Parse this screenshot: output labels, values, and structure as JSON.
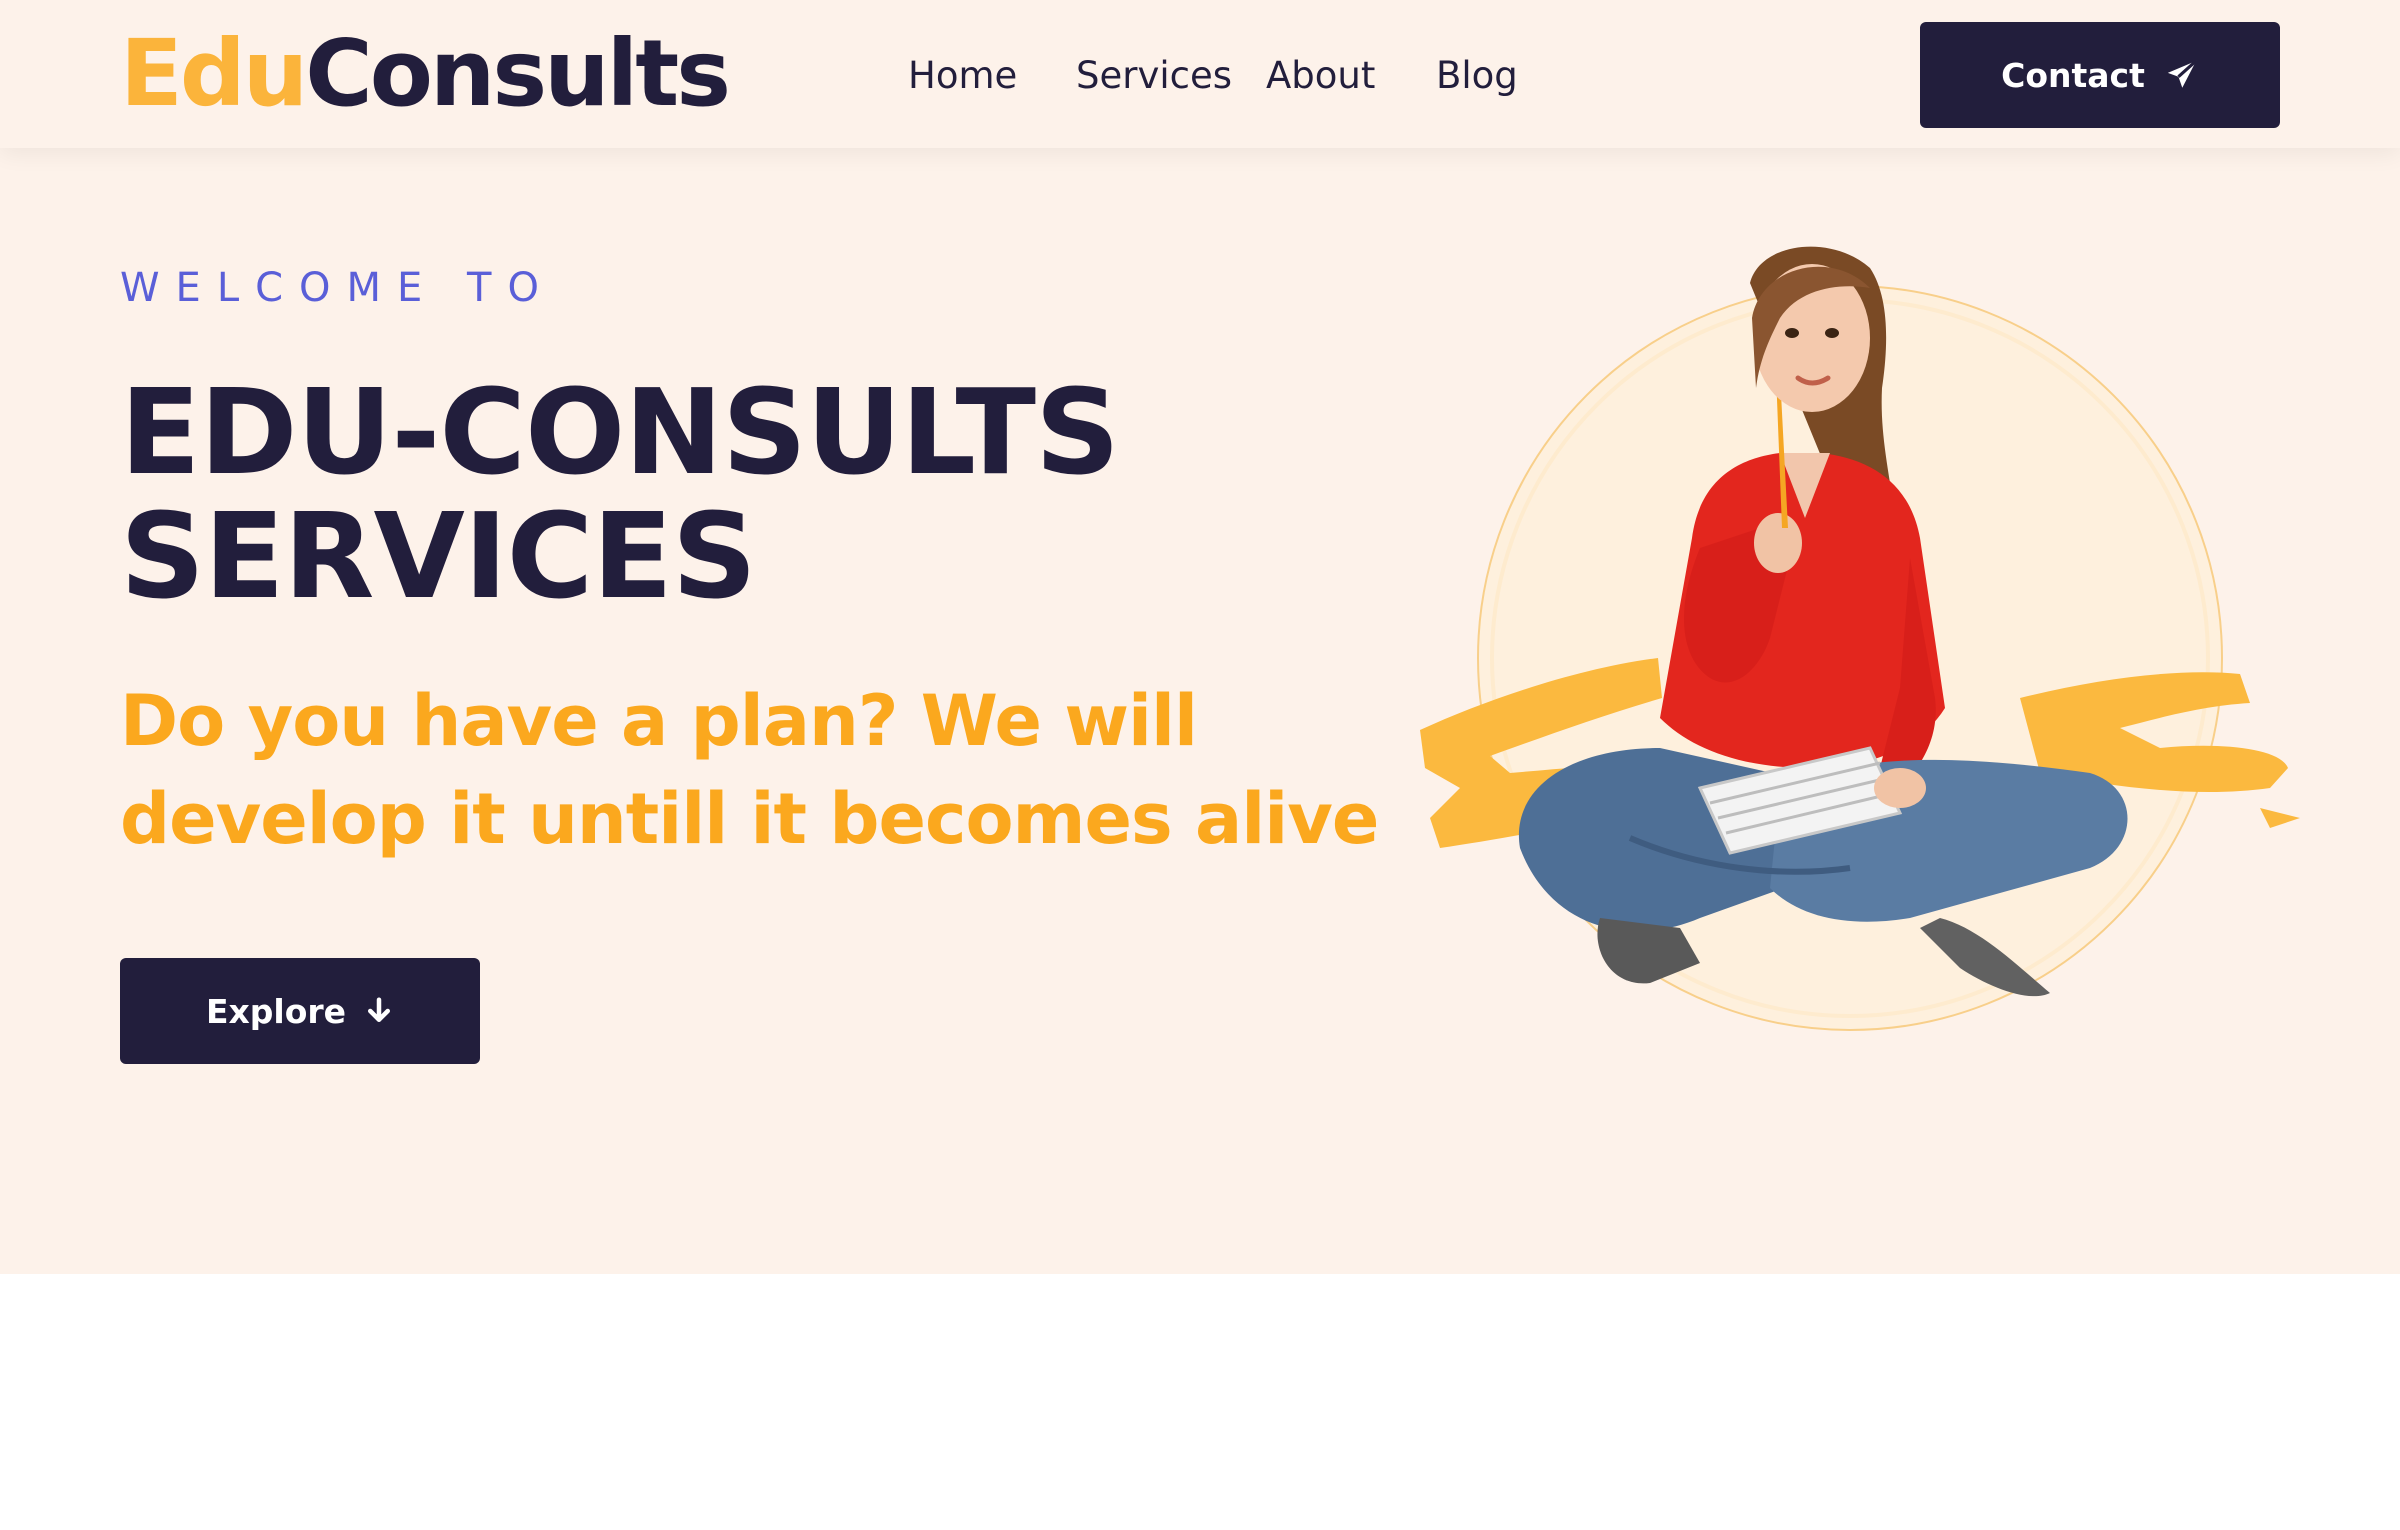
{
  "navbar": {
    "logo": {
      "part1": "Edu",
      "part2": "Consults"
    },
    "links": [
      {
        "label": "Home"
      },
      {
        "label": "Services"
      },
      {
        "label": "About"
      },
      {
        "label": "Blog"
      }
    ],
    "contact_button": {
      "label": "Contact",
      "icon": "paper-plane-icon"
    }
  },
  "hero": {
    "eyebrow": "WELCOME TO",
    "title_line1": "EDU-CONSULTS",
    "title_line2": "SERVICES",
    "subtitle": "Do you have a plan? We will develop it untill it becomes alive",
    "explore_button": {
      "label": "Explore",
      "icon": "arrow-down-icon"
    },
    "image": "woman-sitting-with-notebook-and-pencil"
  },
  "colors": {
    "navy": "#221e3c",
    "accent_yellow": "#fbb43b",
    "subtitle_orange": "#fba81e",
    "eyebrow_blue": "#5a5fd8",
    "hero_background": "#fdf2ea"
  }
}
